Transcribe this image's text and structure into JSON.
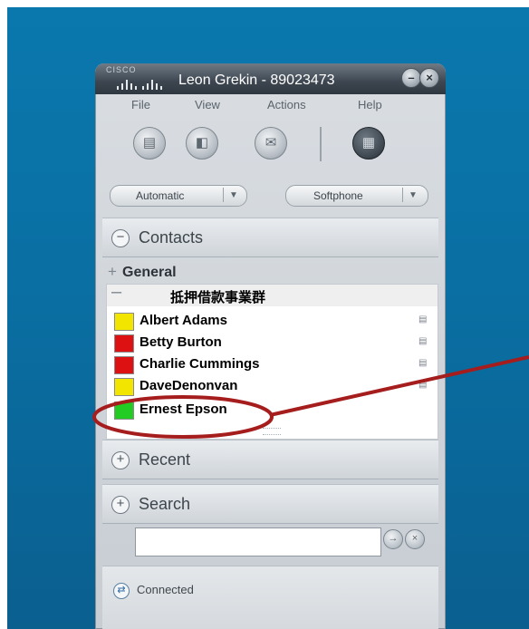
{
  "window": {
    "brand": "CISCO",
    "title": "Leon Grekin - 89023473",
    "minimize_glyph": "–",
    "close_glyph": "×"
  },
  "menu": [
    "File",
    "View",
    "Actions",
    "Help"
  ],
  "toolbar": {
    "icons": [
      "contact-card-icon",
      "video-call-icon",
      "mail-icon",
      "dialpad-icon"
    ],
    "status_select": "Automatic",
    "device_select": "Softphone",
    "dropdown_glyph": "▼"
  },
  "sections": {
    "contacts": "Contacts",
    "recent": "Recent",
    "search": "Search"
  },
  "contacts": {
    "general_group": "General",
    "subgroup": "抵押借款事業群",
    "items": [
      {
        "name": "Albert Adams",
        "status_color": "#f2e600"
      },
      {
        "name": "Betty Burton",
        "status_color": "#dd1111"
      },
      {
        "name": "Charlie Cummings",
        "status_color": "#dd1111"
      },
      {
        "name": "DaveDenonvan",
        "status_color": "#f2e600"
      },
      {
        "name": "Ernest Epson",
        "status_color": "#22cc22"
      }
    ]
  },
  "search": {
    "value": "",
    "go_glyph": "→",
    "clear_glyph": "×"
  },
  "status_bar": {
    "text": "Connected"
  },
  "colors": {
    "background": "#0a6fa3",
    "callout": "#a51d1d"
  }
}
